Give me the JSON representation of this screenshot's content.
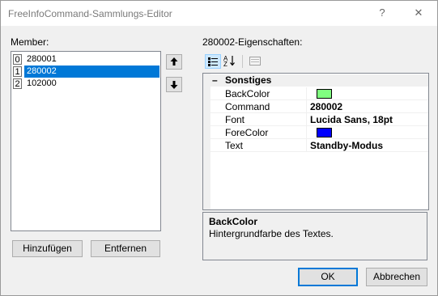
{
  "window": {
    "title": "FreeInfoCommand-Sammlungs-Editor",
    "help_label": "?",
    "close_label": "✕"
  },
  "members": {
    "label": "Member:",
    "items": [
      {
        "index": "0",
        "value": "280001",
        "selected": false
      },
      {
        "index": "1",
        "value": "280002",
        "selected": true
      },
      {
        "index": "2",
        "value": "102000",
        "selected": false
      }
    ],
    "move_up_icon": "arrow-up",
    "move_down_icon": "arrow-down",
    "add_label": "Hinzufügen",
    "remove_label": "Entfernen"
  },
  "properties": {
    "label": "280002-Eigenschaften:",
    "toolbar_icons": [
      "categorized-icon",
      "alphabetical-icon",
      "property-pages-icon"
    ],
    "category": "Sonstiges",
    "category_toggle": "–",
    "rows": [
      {
        "name": "BackColor",
        "value": "",
        "swatch": "#80ff80"
      },
      {
        "name": "Command",
        "value": "280002",
        "swatch": null
      },
      {
        "name": "Font",
        "value": "Lucida Sans, 18pt",
        "swatch": null
      },
      {
        "name": "ForeColor",
        "value": "",
        "swatch": "#0000ff"
      },
      {
        "name": "Text",
        "value": "Standby-Modus",
        "swatch": null
      }
    ],
    "description_title": "BackColor",
    "description_text": "Hintergrundfarbe des Textes."
  },
  "footer": {
    "ok_label": "OK",
    "cancel_label": "Abbrechen"
  }
}
